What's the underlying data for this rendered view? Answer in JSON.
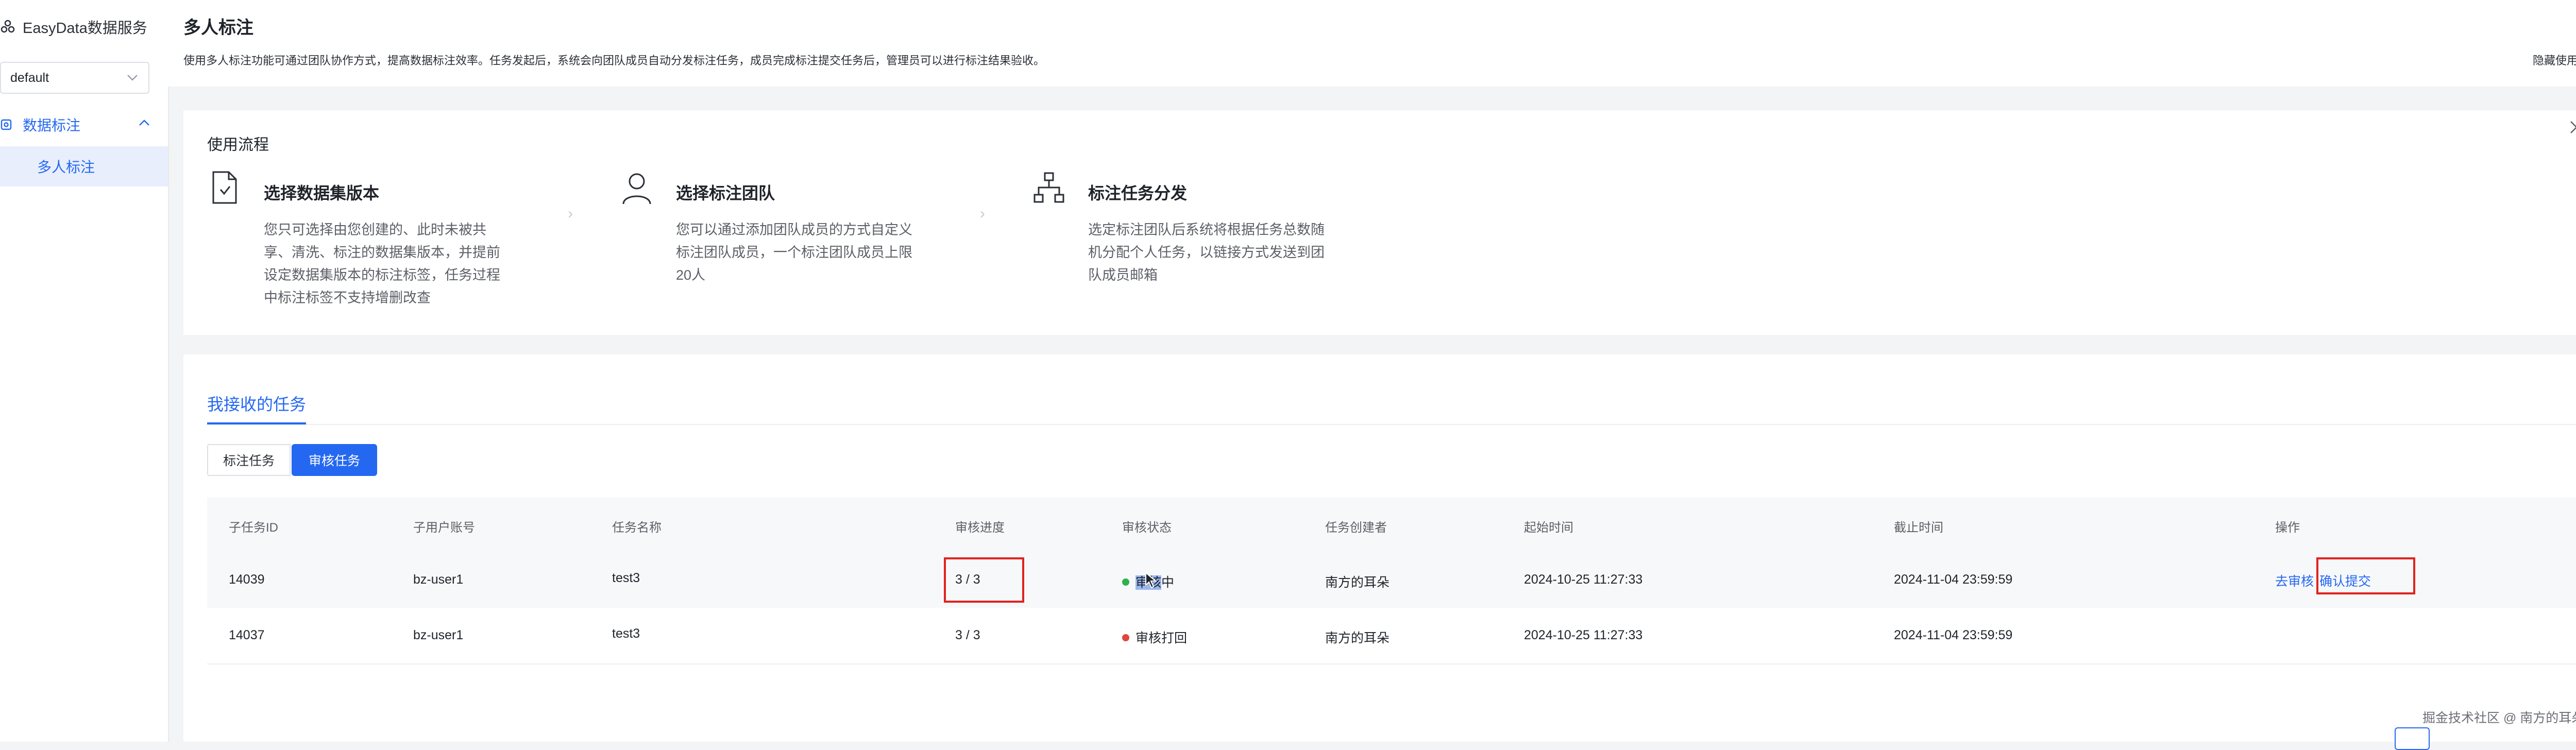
{
  "app": {
    "name": "EasyData数据服务"
  },
  "sidebar": {
    "workspace": "default",
    "group_label": "数据标注",
    "sub_item": "多人标注"
  },
  "header": {
    "title": "多人标注",
    "description": "使用多人标注功能可通过团队协作方式，提高数据标注效率。任务发起后，系统会向团队成员自动分发标注任务，成员完成标注提交任务后，管理员可以进行标注结果验收。",
    "hide_guide": "隐藏使用流程"
  },
  "guide": {
    "title": "使用流程",
    "steps": [
      {
        "icon": "file-check-icon",
        "title": "选择数据集版本",
        "lines": [
          "您只可选择由您创建的、此时未被共",
          "享、清洗、标注的数据集版本，并提前",
          "设定数据集版本的标注标签，任务过程",
          "中标注标签不支持增删改查"
        ]
      },
      {
        "icon": "user-icon",
        "title": "选择标注团队",
        "lines": [
          "您可以通过添加团队成员的方式自定义",
          "标注团队成员，一个标注团队成员上限",
          "20人"
        ]
      },
      {
        "icon": "org-chart-icon",
        "title": "标注任务分发",
        "lines": [
          "选定标注团队后系统将根据任务总数随",
          "机分配个人任务，以链接方式发送到团",
          "队成员邮箱"
        ]
      }
    ]
  },
  "tasks": {
    "tab_label": "我接收的任务",
    "btn_label_task": "标注任务",
    "btn_review_task": "审核任务",
    "columns": [
      "子任务ID",
      "子用户账号",
      "任务名称",
      "审核进度",
      "审核状态",
      "任务创建者",
      "起始时间",
      "截止时间",
      "操作"
    ],
    "rows": [
      {
        "id": "14039",
        "user": "bz-user1",
        "name": "test3",
        "progress": "3 / 3",
        "status_a": "审核",
        "status_b": "中",
        "status_color": "#2fb24a",
        "creator": "南方的耳朵",
        "start": "2024-10-25 11:27:33",
        "end": "2024-11-04 23:59:59",
        "action1": "去审核",
        "action2": "确认提交"
      },
      {
        "id": "14037",
        "user": "bz-user1",
        "name": "test3",
        "progress": "3 / 3",
        "status_a": "审核打回",
        "status_b": "",
        "status_color": "#e0463b",
        "creator": "南方的耳朵",
        "start": "2024-10-25 11:27:33",
        "end": "2024-11-04 23:59:59",
        "action1": "",
        "action2": ""
      }
    ]
  },
  "footer": {
    "watermark": "掘金技术社区 @ 南方的耳朵"
  },
  "colors": {
    "accent": "#2468f2",
    "highlight": "#e0231e"
  }
}
